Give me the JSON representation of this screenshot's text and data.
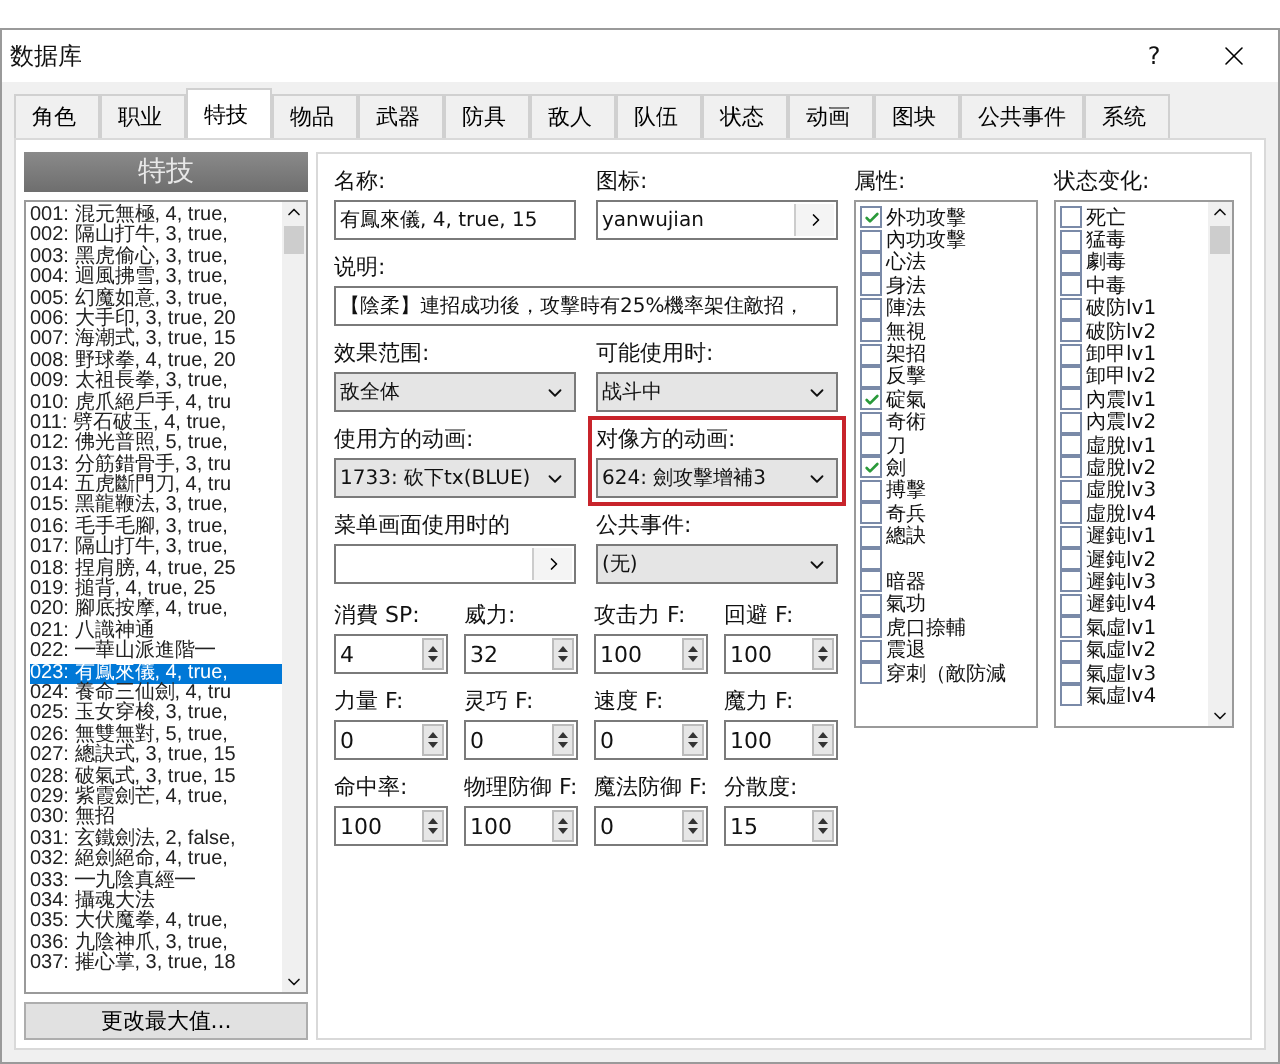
{
  "window": {
    "title": "数据库",
    "help": "?"
  },
  "tabs": [
    {
      "label": "角色",
      "selected": false
    },
    {
      "label": "职业",
      "selected": false
    },
    {
      "label": "特技",
      "selected": true
    },
    {
      "label": "物品",
      "selected": false
    },
    {
      "label": "武器",
      "selected": false
    },
    {
      "label": "防具",
      "selected": false
    },
    {
      "label": "敌人",
      "selected": false
    },
    {
      "label": "队伍",
      "selected": false
    },
    {
      "label": "状态",
      "selected": false
    },
    {
      "label": "动画",
      "selected": false
    },
    {
      "label": "图块",
      "selected": false
    },
    {
      "label": "公共事件",
      "selected": false
    },
    {
      "label": "系统",
      "selected": false
    }
  ],
  "skill_list": {
    "title": "特技",
    "button": "更改最大值...",
    "items": [
      {
        "number": "001:",
        "text": "混元無極, 4, true,",
        "selected": false
      },
      {
        "number": "002:",
        "text": "隔山打牛, 3, true,",
        "selected": false
      },
      {
        "number": "003:",
        "text": "黑虎偷心, 3, true,",
        "selected": false
      },
      {
        "number": "004:",
        "text": "迴風拂雪, 3, true,",
        "selected": false
      },
      {
        "number": "005:",
        "text": "幻魔如意, 3, true,",
        "selected": false
      },
      {
        "number": "006:",
        "text": "大手印, 3, true, 20",
        "selected": false
      },
      {
        "number": "007:",
        "text": "海潮式, 3, true, 15",
        "selected": false
      },
      {
        "number": "008:",
        "text": "野球拳, 4, true, 20",
        "selected": false
      },
      {
        "number": "009:",
        "text": "太祖長拳, 3, true,",
        "selected": false
      },
      {
        "number": "010:",
        "text": "虎爪絕戶手, 4, tru",
        "selected": false
      },
      {
        "number": "011:",
        "text": "劈石破玉, 4, true,",
        "selected": false
      },
      {
        "number": "012:",
        "text": "佛光普照, 5, true,",
        "selected": false
      },
      {
        "number": "013:",
        "text": "分筋錯骨手, 3, tru",
        "selected": false
      },
      {
        "number": "014:",
        "text": "五虎斷門刀, 4, tru",
        "selected": false
      },
      {
        "number": "015:",
        "text": "黑龍鞭法, 3, true,",
        "selected": false
      },
      {
        "number": "016:",
        "text": "毛手毛腳, 3, true,",
        "selected": false
      },
      {
        "number": "017:",
        "text": "隔山打牛, 3, true,",
        "selected": false
      },
      {
        "number": "018:",
        "text": "捏肩膀, 4, true, 25",
        "selected": false
      },
      {
        "number": "019:",
        "text": "搥背, 4, true, 25",
        "selected": false
      },
      {
        "number": "020:",
        "text": "腳底按摩, 4, true,",
        "selected": false
      },
      {
        "number": "021:",
        "text": "八識神通",
        "selected": false
      },
      {
        "number": "022:",
        "text": "━華山派進階━",
        "selected": false
      },
      {
        "number": "023:",
        "text": "有鳳來儀, 4, true,",
        "selected": true
      },
      {
        "number": "024:",
        "text": "養命三仙劍, 4, tru",
        "selected": false
      },
      {
        "number": "025:",
        "text": "玉女穿梭, 3, true,",
        "selected": false
      },
      {
        "number": "026:",
        "text": "無雙無對, 5, true,",
        "selected": false
      },
      {
        "number": "027:",
        "text": "總訣式, 3, true, 15",
        "selected": false
      },
      {
        "number": "028:",
        "text": "破氣式, 3, true, 15",
        "selected": false
      },
      {
        "number": "029:",
        "text": "紫霞劍芒, 4, true,",
        "selected": false
      },
      {
        "number": "030:",
        "text": "無招",
        "selected": false
      },
      {
        "number": "031:",
        "text": "玄鐵劍法, 2, false,",
        "selected": false
      },
      {
        "number": "032:",
        "text": "絕劍絕命, 4, true,",
        "selected": false
      },
      {
        "number": "033:",
        "text": "━九陰真經━",
        "selected": false
      },
      {
        "number": "034:",
        "text": "攝魂大法",
        "selected": false
      },
      {
        "number": "035:",
        "text": "大伏魔拳, 4, true,",
        "selected": false
      },
      {
        "number": "036:",
        "text": "九陰神爪, 3, true,",
        "selected": false
      },
      {
        "number": "037:",
        "text": "摧心掌, 3, true, 18",
        "selected": false
      }
    ]
  },
  "form_rows": [
    [
      {
        "kind": "text",
        "label": "名称:",
        "value": "有鳳來儀, 4, true, 15"
      },
      {
        "kind": "picker",
        "label": "图标:",
        "value": "yanwujian"
      }
    ],
    [
      {
        "kind": "text",
        "label": "说明:",
        "value": "【陰柔】連招成功後，攻擊時有25%機率架住敵招，"
      }
    ],
    [
      {
        "kind": "select",
        "label": "效果范围:",
        "value": "敌全体"
      },
      {
        "kind": "select",
        "label": "可能使用时:",
        "value": "战斗中"
      }
    ],
    [
      {
        "kind": "select",
        "label": "使用方的动画:",
        "value": "1733: 砍下tx(BLUE)"
      },
      {
        "kind": "select",
        "label": "对像方的动画:",
        "value": "624: 劍攻擊增補3",
        "highlighted": true
      }
    ],
    [
      {
        "kind": "picker",
        "label": "菜单画面使用时的"
      },
      {
        "kind": "select",
        "label": "公共事件:",
        "value": "(无)"
      }
    ]
  ],
  "stats": [
    {
      "label": "消費 SP:",
      "value": "4"
    },
    {
      "label": "威力:",
      "value": "32"
    },
    {
      "label": "攻击力 F:",
      "value": "100"
    },
    {
      "label": "回避 F:",
      "value": "100"
    },
    {
      "label": "力量 F:",
      "value": "0"
    },
    {
      "label": "灵巧 F:",
      "value": "0"
    },
    {
      "label": "速度 F:",
      "value": "0"
    },
    {
      "label": "魔力 F:",
      "value": "100"
    },
    {
      "label": "命中率:",
      "value": "100"
    },
    {
      "label": "物理防御 F:",
      "value": "100"
    },
    {
      "label": "魔法防御 F:",
      "value": "0"
    },
    {
      "label": "分散度:",
      "value": "15"
    }
  ],
  "attributes": {
    "label": "属性:",
    "items": [
      {
        "label": "外功攻擊",
        "checked": true
      },
      {
        "label": "內功攻擊",
        "checked": false
      },
      {
        "label": "心法",
        "checked": false
      },
      {
        "label": "身法",
        "checked": false
      },
      {
        "label": "陣法",
        "checked": false
      },
      {
        "label": "無視",
        "checked": false
      },
      {
        "label": "架招",
        "checked": false
      },
      {
        "label": "反擊",
        "checked": false
      },
      {
        "label": "碇氣",
        "checked": true
      },
      {
        "label": "奇術",
        "checked": false
      },
      {
        "label": "刀",
        "checked": false
      },
      {
        "label": "劍",
        "checked": true
      },
      {
        "label": "搏擊",
        "checked": false
      },
      {
        "label": "奇兵",
        "checked": false
      },
      {
        "label": "總訣",
        "checked": false
      },
      {
        "checked": false
      },
      {
        "label": "暗器",
        "checked": false
      },
      {
        "label": "氣功",
        "checked": false
      },
      {
        "label": "虎口捺輔",
        "checked": false
      },
      {
        "label": "震退",
        "checked": false
      },
      {
        "label": "穿刺（敵防減",
        "checked": false
      }
    ]
  },
  "states": {
    "label": "状态变化:",
    "items": [
      {
        "label": "死亡",
        "checked": false
      },
      {
        "label": "猛毒",
        "checked": false
      },
      {
        "label": "劇毒",
        "checked": false
      },
      {
        "label": "中毒",
        "checked": false
      },
      {
        "label": "破防lv1",
        "checked": false
      },
      {
        "label": "破防lv2",
        "checked": false
      },
      {
        "label": "卸甲lv1",
        "checked": false
      },
      {
        "label": "卸甲lv2",
        "checked": false
      },
      {
        "label": "內震lv1",
        "checked": false
      },
      {
        "label": "內震lv2",
        "checked": false
      },
      {
        "label": "虛脫lv1",
        "checked": false
      },
      {
        "label": "虛脫lv2",
        "checked": false
      },
      {
        "label": "虛脫lv3",
        "checked": false
      },
      {
        "label": "虛脫lv4",
        "checked": false
      },
      {
        "label": "遲鈍lv1",
        "checked": false
      },
      {
        "label": "遲鈍lv2",
        "checked": false
      },
      {
        "label": "遲鈍lv3",
        "checked": false
      },
      {
        "label": "遲鈍lv4",
        "checked": false
      },
      {
        "label": "氣虛lv1",
        "checked": false
      },
      {
        "label": "氣虛lv2",
        "checked": false
      },
      {
        "label": "氣虛lv3",
        "checked": false
      },
      {
        "label": "氣虛lv4",
        "checked": false
      }
    ]
  }
}
